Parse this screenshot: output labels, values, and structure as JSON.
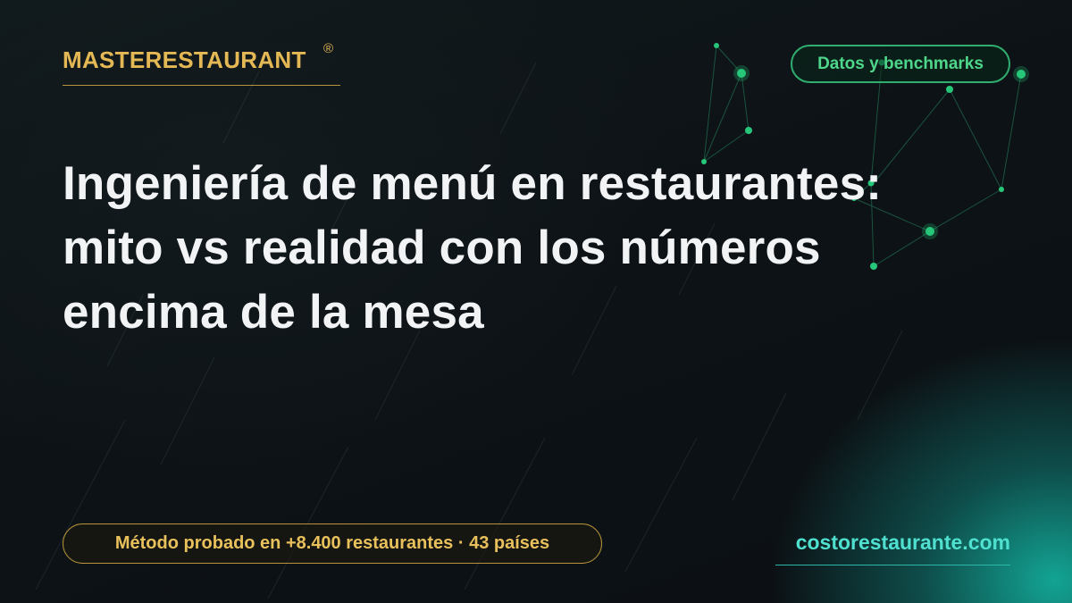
{
  "brand": {
    "name": "MASTERESTAURANT",
    "mark": "®"
  },
  "topic_badge": "Datos y benchmarks",
  "headline": {
    "line1": "Ingeniería de menú en restaurantes:",
    "line2": "mito vs realidad con los números",
    "line3": "encima de la mesa"
  },
  "method_badge": "Método probado en +8.400 restaurantes · 43 países",
  "website": "costorestaurante.com",
  "colors": {
    "background": "#0d1117",
    "gold": "#e4b854",
    "green": "#4ed68a",
    "teal": "#4fe0cf",
    "headline": "#f1f3f5"
  }
}
